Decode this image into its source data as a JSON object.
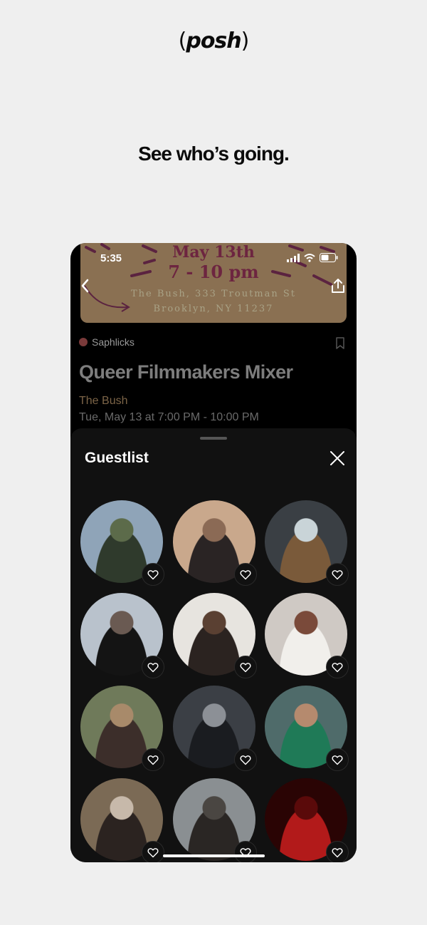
{
  "brand": {
    "logo_open": "(",
    "logo_text": "posh",
    "logo_close": ")"
  },
  "tagline": "See who’s going.",
  "status_bar": {
    "time": "5:35"
  },
  "flyer": {
    "date": "May 13th",
    "time": "7 - 10 pm",
    "address_line1": "The Bush, 333 Troutman St",
    "address_line2": "Brooklyn, NY 11237"
  },
  "event": {
    "host": "Saphlicks",
    "title": "Queer Filmmakers Mixer",
    "venue": "The Bush",
    "datetime": "Tue, May 13 at 7:00 PM - 10:00 PM"
  },
  "guestlist": {
    "title": "Guestlist",
    "guests": [
      {
        "colors": [
          "#8fa4b8",
          "#2f3a2c",
          "#5c6b4a"
        ]
      },
      {
        "colors": [
          "#c9a88c",
          "#2a2424",
          "#8b6a55"
        ]
      },
      {
        "colors": [
          "#3a3f44",
          "#7a5a3a",
          "#c9d4d8"
        ]
      },
      {
        "colors": [
          "#b9c2cc",
          "#141414",
          "#6a5a52"
        ]
      },
      {
        "colors": [
          "#e7e4df",
          "#2b2320",
          "#5a4032"
        ]
      },
      {
        "colors": [
          "#cfc9c4",
          "#f1efeb",
          "#7a4a3a"
        ]
      },
      {
        "colors": [
          "#6f7a5a",
          "#3c2e2a",
          "#a88a6a"
        ]
      },
      {
        "colors": [
          "#3b3f45",
          "#1a1c20",
          "#8c9096"
        ]
      },
      {
        "colors": [
          "#4f6b6a",
          "#1f7a57",
          "#b58a6e"
        ]
      },
      {
        "colors": [
          "#7b6a55",
          "#2b2320",
          "#c7b9aa"
        ]
      },
      {
        "colors": [
          "#8a8f92",
          "#2a2624",
          "#4a4642"
        ]
      },
      {
        "colors": [
          "#2a0404",
          "#b21a1a",
          "#5a0a0a"
        ]
      }
    ]
  },
  "colors": {
    "background": "#efefef",
    "phone": "#000000",
    "sheet": "#111111",
    "venue": "#7c6447"
  }
}
